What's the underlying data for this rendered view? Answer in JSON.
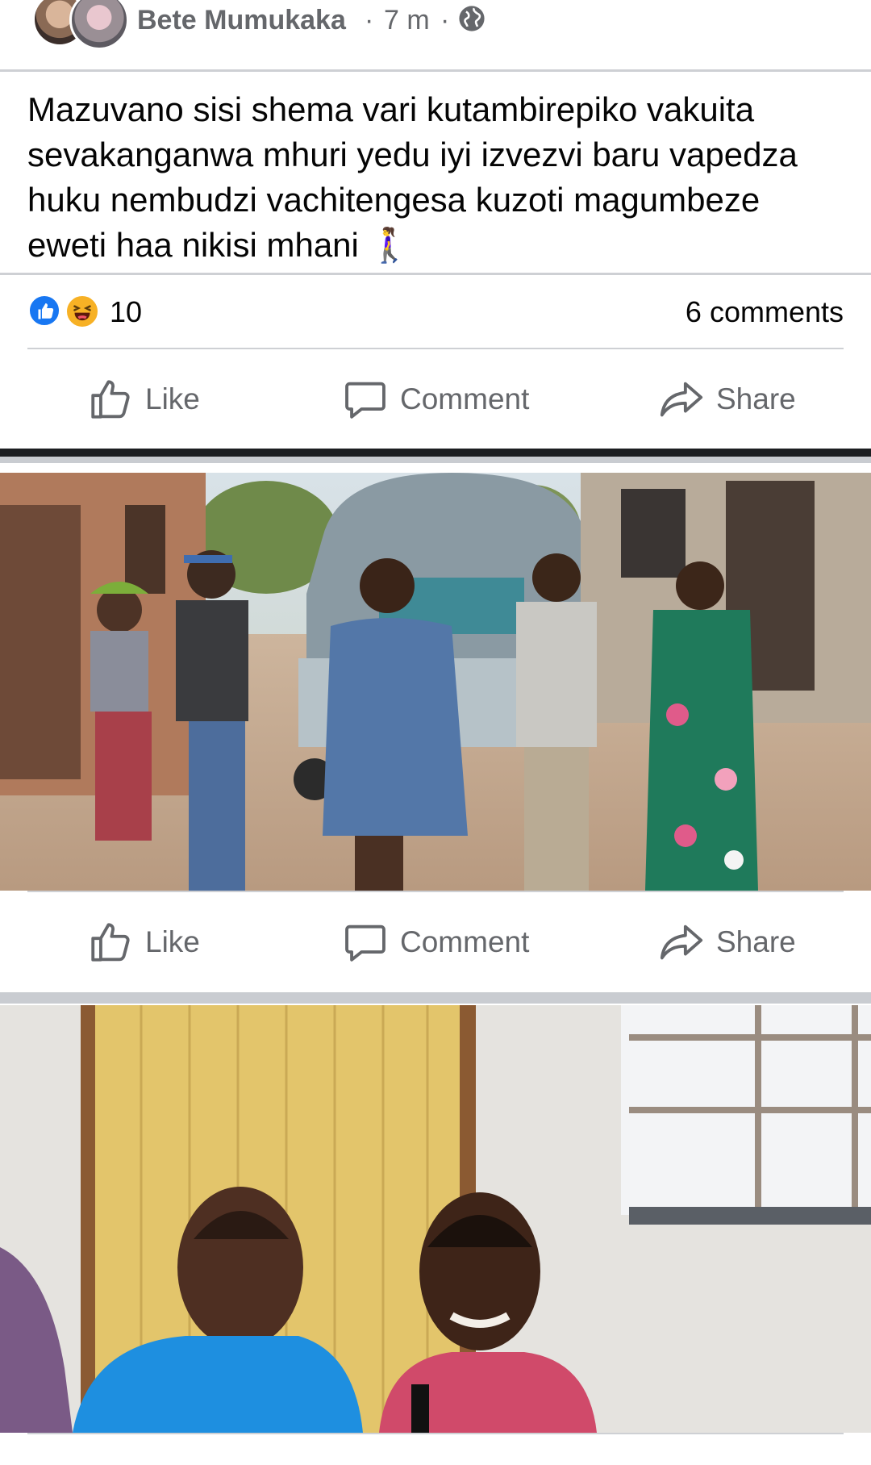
{
  "post": {
    "author": "Bete Mumukaka",
    "separator": "·",
    "time": "7 m",
    "text": "Mazuvano sisi shema vari kutambirepiko vakuita sevakanganwa mhuri yedu iyi izvezvi baru vapedza huku nembudzi vachitengesa kuzoti magumbeze eweti haa nikisi mhani 🚶‍♀️",
    "reactions_count": "10",
    "comments_count": "6 comments"
  },
  "actions": {
    "like": "Like",
    "comment": "Comment",
    "share": "Share"
  },
  "icons": {
    "privacy": "globe-icon",
    "like": "thumbs-up-icon",
    "comment": "speech-bubble-icon",
    "share": "share-arrow-icon",
    "reaction_like": "like-reaction-icon",
    "reaction_haha": "haha-reaction-icon"
  },
  "colors": {
    "brand_blue": "#1877f2",
    "haha_yellow": "#f7b125",
    "secondary_text": "#65676b",
    "divider": "#ced0d4"
  }
}
